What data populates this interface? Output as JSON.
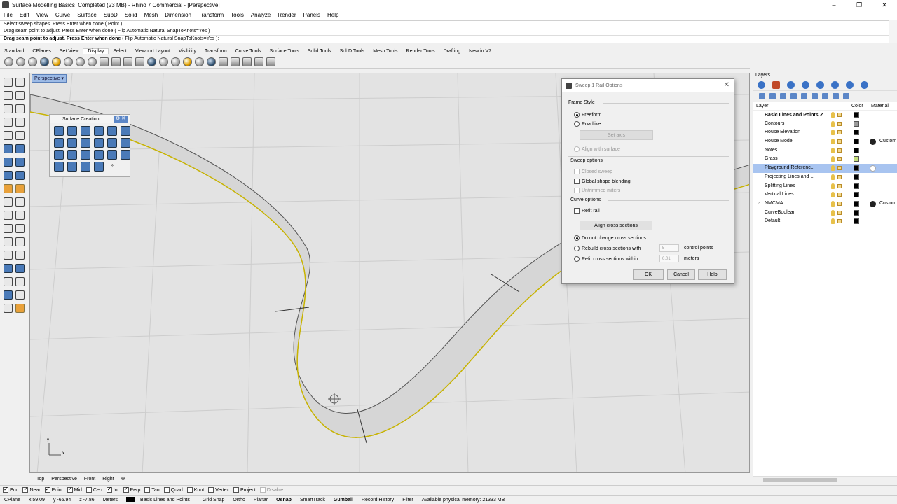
{
  "window": {
    "title": "Surface Modelling Basics_Completed (23 MB) - Rhino 7 Commercial - [Perspective]",
    "controls": [
      "–",
      "❐",
      "✕"
    ]
  },
  "menu": [
    "File",
    "Edit",
    "View",
    "Curve",
    "Surface",
    "SubD",
    "Solid",
    "Mesh",
    "Dimension",
    "Transform",
    "Tools",
    "Analyze",
    "Render",
    "Panels",
    "Help"
  ],
  "command_history": [
    "Select sweep shapes. Press Enter when done ( Point )",
    "Drag seam point to adjust. Press Enter when done ( Flip  Automatic  Natural  SnapToKnots=Yes )"
  ],
  "command_prompt": {
    "text": "Drag seam point to adjust. Press Enter when done",
    "options": "( Flip  Automatic  Natural  SnapToKnots=Yes ):"
  },
  "toolbar_tabs": [
    "Standard",
    "CPlanes",
    "Set View",
    "Display",
    "Select",
    "Viewport Layout",
    "Visibility",
    "Transform",
    "Curve Tools",
    "Surface Tools",
    "Solid Tools",
    "SubD Tools",
    "Mesh Tools",
    "Render Tools",
    "Drafting",
    "New in V7"
  ],
  "toolbar_active_tab": "Display",
  "viewport": {
    "label": "Perspective",
    "axis_y": "y",
    "axis_x": "x"
  },
  "surface_panel": {
    "title": "Surface Creation",
    "more": "»"
  },
  "viewport_tabs": [
    "Top",
    "Perspective",
    "Front",
    "Right",
    "⊕"
  ],
  "dialog": {
    "title": "Sweep 1 Rail Options",
    "frame_style": "Frame Style",
    "freeform": "Freeform",
    "roadlike": "Roadlike",
    "set_axis": "Set axis",
    "align_surface": "Align with surface",
    "sweep_options": "Sweep options",
    "closed_sweep": "Closed sweep",
    "global_blending": "Global shape blending",
    "untrimmed": "Untrimmed miters",
    "curve_options": "Curve options",
    "refit_rail": "Refit rail",
    "align_cross": "Align cross sections",
    "no_change": "Do not change cross sections",
    "rebuild": "Rebuild cross sections with",
    "rebuild_value": "5",
    "rebuild_unit": "control points",
    "refit": "Refit cross sections within",
    "refit_value": "0.01",
    "refit_unit": "meters",
    "ok": "OK",
    "cancel": "Cancel",
    "help": "Help"
  },
  "layers": {
    "panel_title": "Layers",
    "col_layer": "Layer",
    "col_color": "Color",
    "col_material": "Material",
    "rows": [
      {
        "name": "Basic Lines and Points ✓",
        "color": "#000000",
        "bold": true
      },
      {
        "name": "Contours",
        "color": "#9a9a9a"
      },
      {
        "name": "House Elevation",
        "color": "#000000"
      },
      {
        "name": "House Model",
        "color": "#000000",
        "material": "Custom"
      },
      {
        "name": "Notes",
        "color": "#000000"
      },
      {
        "name": "Grass",
        "color": "#c6e07a"
      },
      {
        "name": "Playground Referenc...",
        "color": "#000000",
        "selected": true
      },
      {
        "name": "Projecting Lines and ...",
        "color": "#000000"
      },
      {
        "name": "Splitting Lines",
        "color": "#000000"
      },
      {
        "name": "Vertical Lines",
        "color": "#000000"
      },
      {
        "name": "NMCMA",
        "color": "#000000",
        "material": "Custom",
        "expandable": true
      },
      {
        "name": "CurveBoolean",
        "color": "#000000"
      },
      {
        "name": "Default",
        "color": "#000000"
      }
    ]
  },
  "osnaps": [
    {
      "label": "End",
      "on": true
    },
    {
      "label": "Near",
      "on": true
    },
    {
      "label": "Point",
      "on": true
    },
    {
      "label": "Mid",
      "on": true
    },
    {
      "label": "Cen",
      "on": false
    },
    {
      "label": "Int",
      "on": true
    },
    {
      "label": "Perp",
      "on": true
    },
    {
      "label": "Tan",
      "on": false
    },
    {
      "label": "Quad",
      "on": false
    },
    {
      "label": "Knot",
      "on": false
    },
    {
      "label": "Vertex",
      "on": false
    },
    {
      "label": "Project",
      "on": false
    },
    {
      "label": "Disable",
      "on": false,
      "disabled": true
    }
  ],
  "status": {
    "cplane": "CPlane",
    "x": "x 59.09",
    "y": "y -65.94",
    "z": "z -7.86",
    "units": "Meters",
    "layer": "Basic Lines and Points",
    "toggles": [
      "Grid Snap",
      "Ortho",
      "Planar",
      "Osnap",
      "SmartTrack",
      "Gumball",
      "Record History",
      "Filter"
    ],
    "memory": "Available physical memory: 21333 MB"
  }
}
